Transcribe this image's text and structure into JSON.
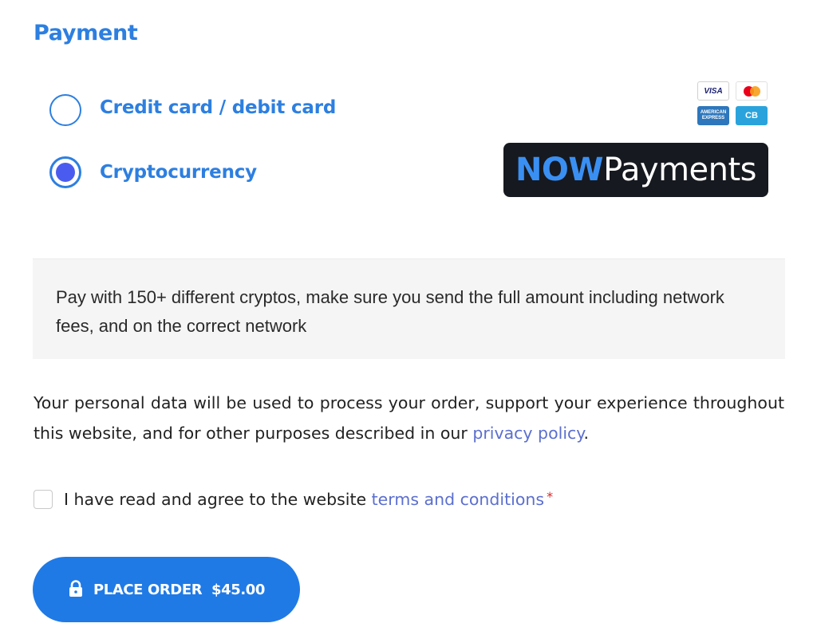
{
  "payment": {
    "heading": "Payment",
    "options": [
      {
        "label": "Credit card / debit card",
        "selected": false,
        "cards": [
          "VISA",
          "Mastercard",
          "AMERICAN EXPRESS",
          "CB"
        ]
      },
      {
        "label": "Cryptocurrency",
        "selected": true,
        "provider_logo": {
          "now": "NOW",
          "rest": "Payments"
        }
      }
    ],
    "crypto_description": "Pay with 150+ different cryptos, make sure you send the full amount including network fees, and on the correct network"
  },
  "privacy": {
    "text_before": "Your personal data will be used to process your order, support your experience throughout this website, and for other purposes described in our ",
    "link_text": "privacy policy",
    "text_after": "."
  },
  "terms": {
    "text_before": "I have read and agree to the website ",
    "link_text": "terms and conditions",
    "required_mark": "*",
    "checked": false
  },
  "place_order": {
    "label": "PLACE ORDER",
    "amount": "$45.00",
    "icon": "lock-icon"
  },
  "colors": {
    "accent": "#2d7fe0",
    "radio_fill": "#4a5cf0",
    "link": "#5b6fcf",
    "button": "#1f7ae6",
    "required": "#d12a2a"
  }
}
